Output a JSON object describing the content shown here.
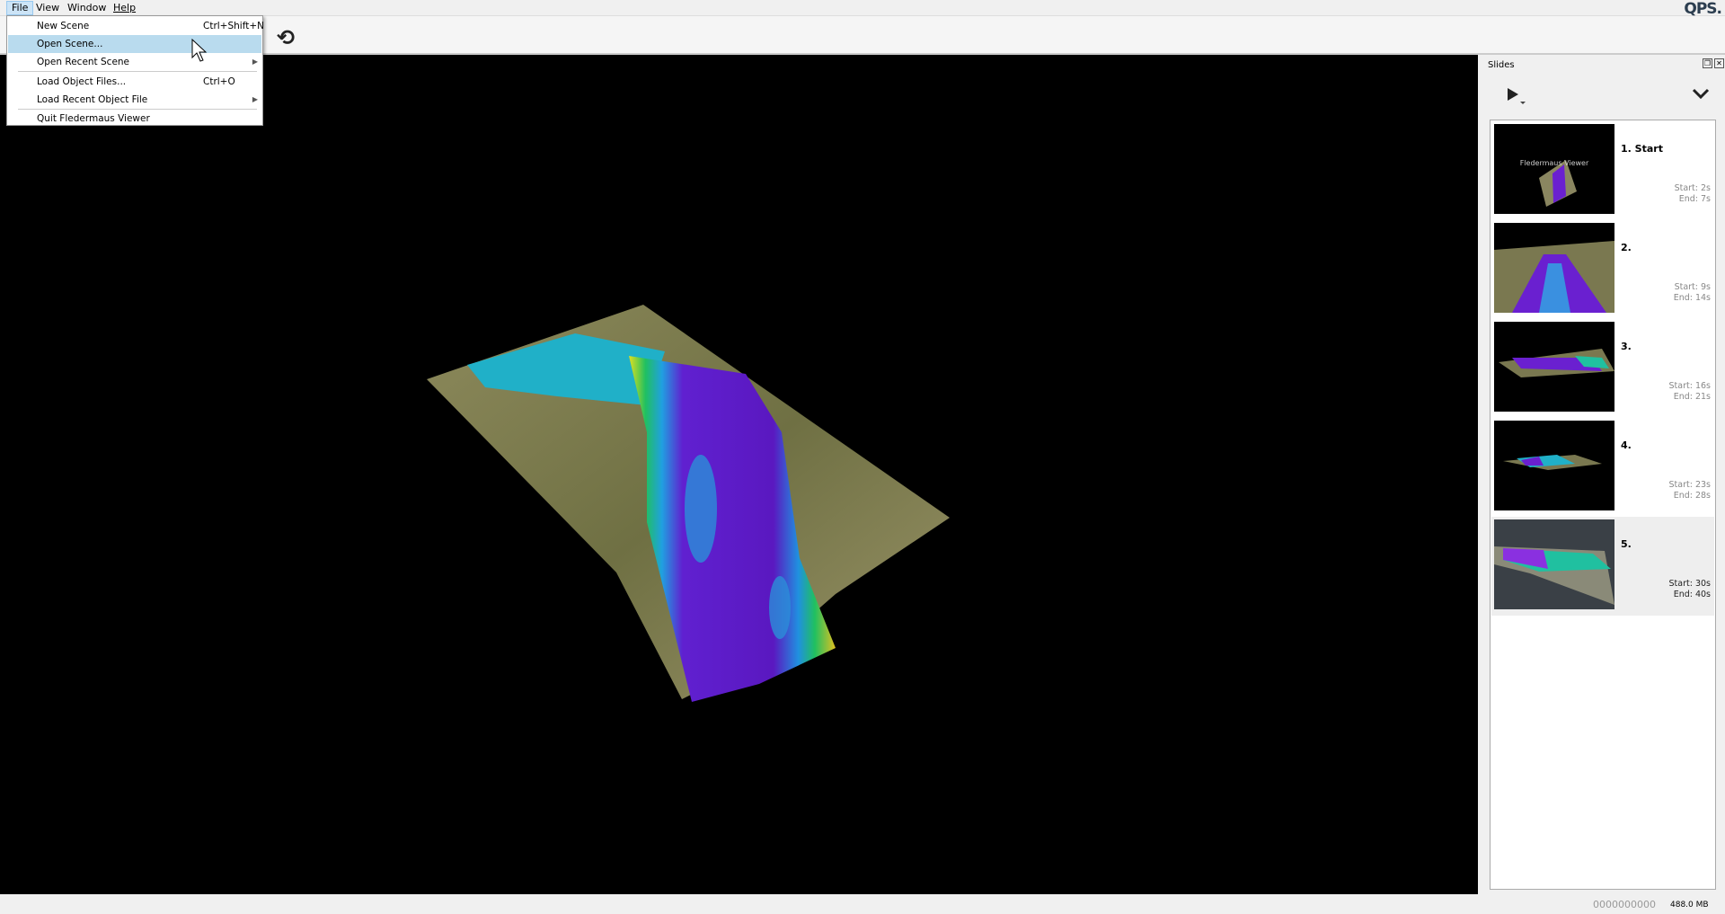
{
  "menubar": {
    "items": [
      "File",
      "View",
      "Window",
      "Help"
    ],
    "logo": "QPS."
  },
  "file_menu": {
    "items": [
      {
        "label": "New Scene",
        "shortcut": "Ctrl+Shift+N"
      },
      {
        "label": "Open Scene...",
        "shortcut": ""
      },
      {
        "label": "Open Recent Scene",
        "shortcut": ""
      },
      {
        "label": "Load Object Files...",
        "shortcut": "Ctrl+O"
      },
      {
        "label": "Load Recent Object File",
        "shortcut": ""
      },
      {
        "label": "Quit Fledermaus Viewer",
        "shortcut": ""
      }
    ]
  },
  "slides": {
    "title": "Slides",
    "items": [
      {
        "name": "1. Start",
        "start": "Start: 2s",
        "end": "End: 7s",
        "thumb_text": "Fledermaus Viewer"
      },
      {
        "name": "2.",
        "start": "Start: 9s",
        "end": "End: 14s"
      },
      {
        "name": "3.",
        "start": "Start: 16s",
        "end": "End: 21s"
      },
      {
        "name": "4.",
        "start": "Start: 23s",
        "end": "End: 28s"
      },
      {
        "name": "5.",
        "start": "Start: 30s",
        "end": "End: 40s"
      }
    ]
  },
  "status": {
    "progress": "0000000000",
    "memory": "488.0 MB"
  }
}
